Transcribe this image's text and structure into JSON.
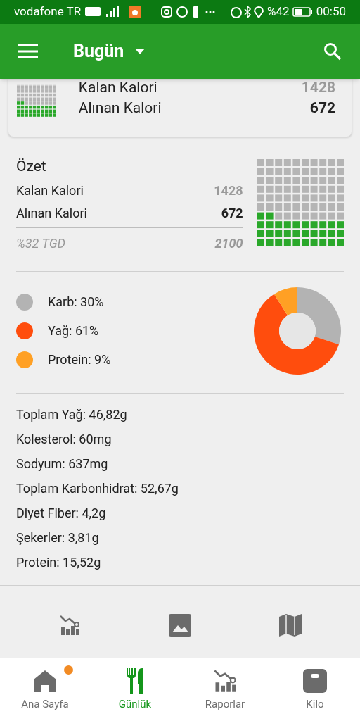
{
  "status_bar": {
    "carrier": "vodafone TR",
    "battery": "%42",
    "time": "00:50"
  },
  "app_bar": {
    "title": "Bugün"
  },
  "top_card": {
    "rows": [
      {
        "label": "Kalan Kalori",
        "value": "1428",
        "kind": "remaining"
      },
      {
        "label": "Alınan Kalori",
        "value": "672",
        "kind": "taken"
      }
    ]
  },
  "summary": {
    "title": "Özet",
    "rows": [
      {
        "label": "Kalan Kalori",
        "value": "1428",
        "kind": "remaining"
      },
      {
        "label": "Alınan Kalori",
        "value": "672",
        "kind": "taken"
      }
    ],
    "footer_label": "%32 TGD",
    "footer_value": "2100"
  },
  "macros": {
    "legend": [
      {
        "label": "Karb: 30%",
        "color": "#b3b3b3"
      },
      {
        "label": "Yağ: 61%",
        "color": "#ff4d0d"
      },
      {
        "label": "Protein: 9%",
        "color": "#ffa024"
      }
    ],
    "chart_data": {
      "type": "donut",
      "values": [
        30,
        61,
        9
      ]
    }
  },
  "nutrients": [
    "Toplam Yağ: 46,82g",
    "Kolesterol: 60mg",
    "Sodyum: 637mg",
    "Toplam Karbonhidrat: 52,67g",
    "Diyet Fiber: 4,2g",
    "Şekerler: 3,81g",
    "Protein: 15,52g"
  ],
  "shortcuts": [
    {
      "kind": "chart"
    },
    {
      "kind": "image"
    },
    {
      "kind": "map"
    }
  ],
  "bottom_nav": [
    {
      "label": "Ana Sayfa",
      "kind": "home",
      "selected": false,
      "badge": true
    },
    {
      "label": "Günlük",
      "kind": "food",
      "selected": true,
      "badge": false
    },
    {
      "label": "Raporlar",
      "kind": "chart",
      "selected": false,
      "badge": false
    },
    {
      "label": "Kilo",
      "kind": "scale",
      "selected": false,
      "badge": false
    }
  ]
}
